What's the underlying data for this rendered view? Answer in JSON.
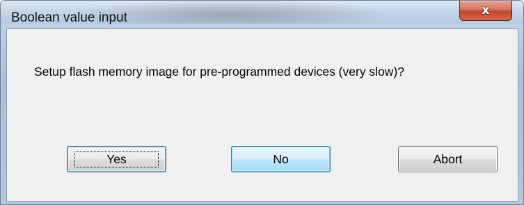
{
  "window": {
    "title": "Boolean value input",
    "close_glyph": "x"
  },
  "dialog": {
    "message": "Setup flash memory image for pre-programmed devices (very slow)?"
  },
  "buttons": {
    "yes_label": "Yes",
    "no_label": "No",
    "abort_label": "Abort"
  },
  "colors": {
    "close_button": "#c2462e",
    "default_button_border": "#3c7fb1",
    "client_background": "#f0f0f0"
  },
  "icons": {
    "close": "close-icon"
  }
}
